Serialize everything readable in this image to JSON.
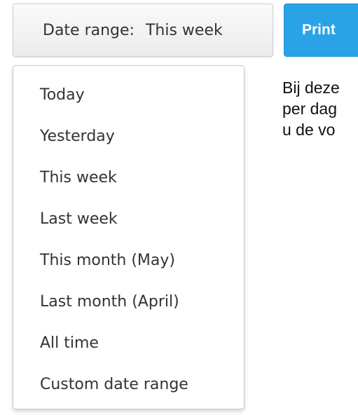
{
  "toolbar": {
    "date_range_label": "Date range:",
    "date_range_value": "This week",
    "print_label": "Print"
  },
  "dropdown": {
    "options": [
      "Today",
      "Yesterday",
      "This week",
      "Last week",
      "This month (May)",
      "Last month (April)",
      "All time",
      "Custom date range"
    ]
  },
  "content": {
    "lines": [
      "Bij deze",
      "per dag",
      "u de vo"
    ]
  },
  "colors": {
    "print_button": "#2aa3e6",
    "button_text": "#333333"
  }
}
